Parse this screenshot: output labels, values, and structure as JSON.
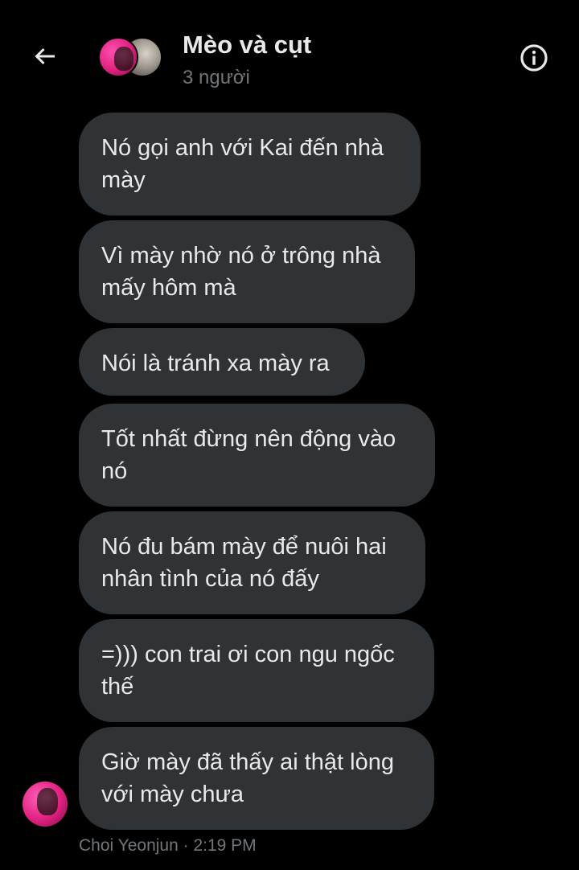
{
  "header": {
    "back_icon": "arrow-left-icon",
    "title": "Mèo và cụt",
    "subtitle": "3 người",
    "info_icon": "info-icon"
  },
  "messages": [
    {
      "text": "Nó gọi anh với Kai đến nhà\nmày"
    },
    {
      "text": "Vì mày nhờ nó ở trông nhà\nmấy hôm mà"
    },
    {
      "text": "Nói là tránh xa mày ra"
    },
    {
      "text": "Tốt nhất đừng nên động vào\nnó"
    },
    {
      "text": "Nó đu bám mày để nuôi hai\nnhân tình của nó đấy"
    },
    {
      "text": "=))) con trai ơi con ngu ngốc\nthế"
    },
    {
      "text": "Giờ mày đã thấy ai thật lòng\nvới mày chưa"
    }
  ],
  "footer": {
    "meta": "Choi Yeonjun · 2:19 PM"
  },
  "colors": {
    "background": "#000000",
    "bubble": "#2f3336",
    "text": "#e7e9ea",
    "muted": "#71767b"
  }
}
